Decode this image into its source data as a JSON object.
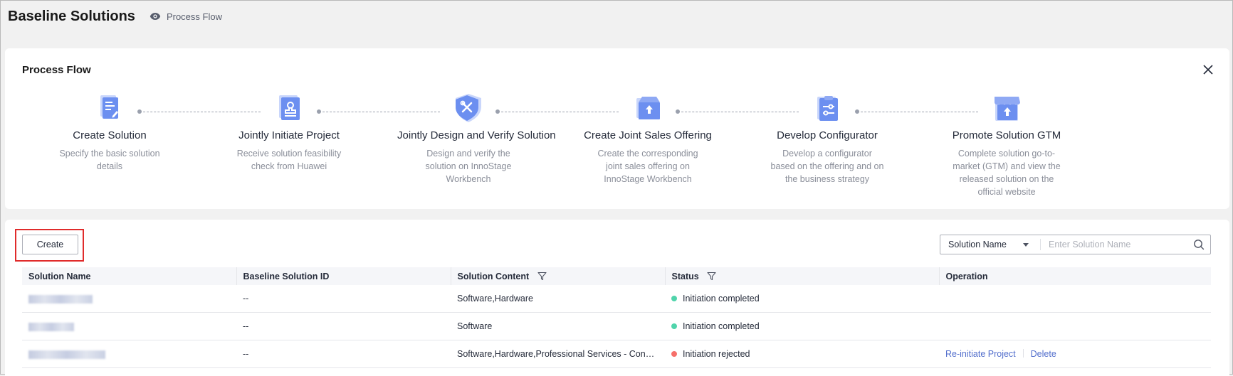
{
  "header": {
    "title": "Baseline Solutions",
    "process_flow_link": "Process Flow"
  },
  "process_flow": {
    "title": "Process Flow",
    "steps": [
      {
        "title": "Create Solution",
        "desc": "Specify the basic solution details",
        "icon": "document-edit-icon"
      },
      {
        "title": "Jointly Initiate Project",
        "desc": "Receive solution feasibility check from Huawei",
        "icon": "stamp-icon"
      },
      {
        "title": "Jointly Design and Verify Solution",
        "desc": "Design and verify the solution on InnoStage Workbench",
        "icon": "shield-tools-icon"
      },
      {
        "title": "Create Joint Sales Offering",
        "desc": "Create the corresponding joint sales offering on InnoStage Workbench",
        "icon": "box-upload-icon"
      },
      {
        "title": "Develop Configurator",
        "desc": "Develop a configurator based on the offering and on the business strategy",
        "icon": "clipboard-config-icon"
      },
      {
        "title": "Promote Solution GTM",
        "desc": "Complete solution go-to-market (GTM) and view the released solution on the official website",
        "icon": "store-upload-icon"
      }
    ]
  },
  "toolbar": {
    "create_label": "Create",
    "search_field": "Solution Name",
    "search_placeholder": "Enter Solution Name"
  },
  "table": {
    "columns": [
      "Solution Name",
      "Baseline Solution ID",
      "Solution Content",
      "Status",
      "Operation"
    ],
    "rows": [
      {
        "id": "--",
        "content": "Software,Hardware",
        "status": "Initiation completed",
        "status_color": "#50d4ab",
        "ops": []
      },
      {
        "id": "--",
        "content": "Software",
        "status": "Initiation completed",
        "status_color": "#50d4ab",
        "ops": []
      },
      {
        "id": "--",
        "content": "Software,Hardware,Professional Services - Consulting and Implementation",
        "status": "Initiation rejected",
        "status_color": "#f66f6a",
        "ops": [
          "Re-initiate Project",
          "Delete"
        ]
      }
    ]
  },
  "colors": {
    "accent": "#526ecc",
    "icon_primary": "#6c8ff0",
    "icon_secondary": "#c9d6fb",
    "highlight_border": "#e02b2b"
  }
}
